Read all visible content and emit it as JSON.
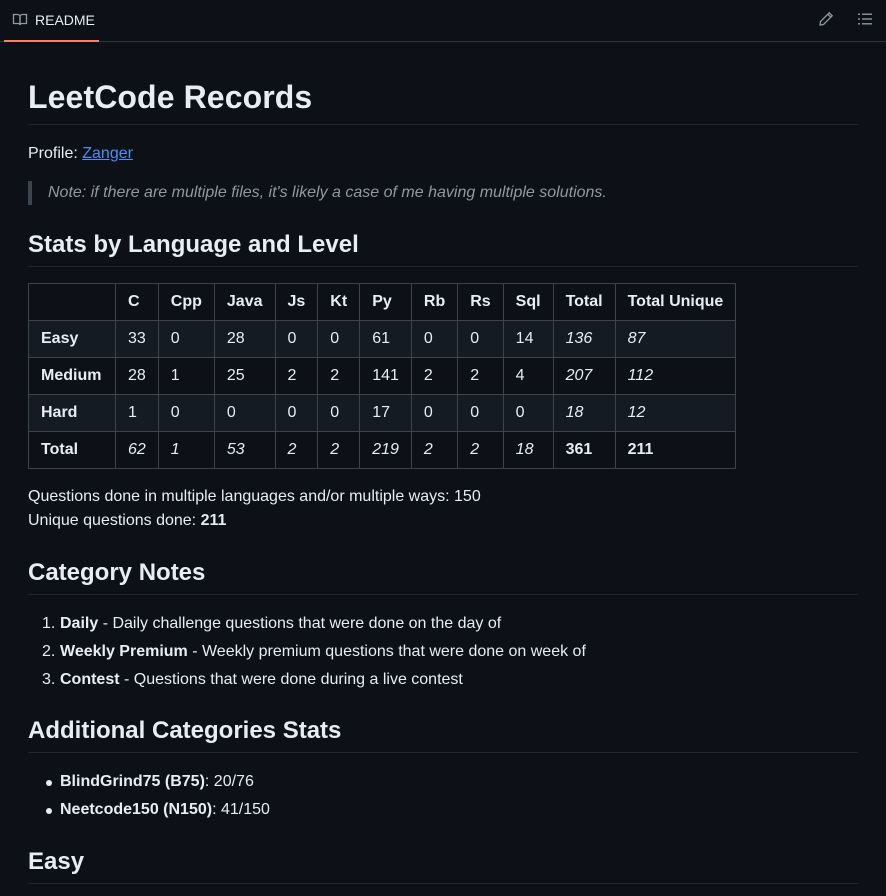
{
  "tab": {
    "label": "README"
  },
  "title": "LeetCode Records",
  "profile": {
    "label": "Profile: ",
    "link_text": "Zanger"
  },
  "note": "Note: if there are multiple files, it's likely a case of me having multiple solutions.",
  "section_stats": "Stats by Language and Level",
  "table": {
    "headers": [
      "",
      "C",
      "Cpp",
      "Java",
      "Js",
      "Kt",
      "Py",
      "Rb",
      "Rs",
      "Sql",
      "Total",
      "Total Unique"
    ],
    "rows": [
      [
        "Easy",
        "33",
        "0",
        "28",
        "0",
        "0",
        "61",
        "0",
        "0",
        "14",
        "136",
        "87"
      ],
      [
        "Medium",
        "28",
        "1",
        "25",
        "2",
        "2",
        "141",
        "2",
        "2",
        "4",
        "207",
        "112"
      ],
      [
        "Hard",
        "1",
        "0",
        "0",
        "0",
        "0",
        "17",
        "0",
        "0",
        "0",
        "18",
        "12"
      ],
      [
        "Total",
        "62",
        "1",
        "53",
        "2",
        "2",
        "219",
        "2",
        "2",
        "18",
        "361",
        "211"
      ]
    ]
  },
  "multi_line": "Questions done in multiple languages and/or multiple ways: 150",
  "unique_label": "Unique questions done: ",
  "unique_value": "211",
  "section_category": "Category Notes",
  "categories": [
    {
      "num": "1.",
      "name": "Daily",
      "desc": " - Daily challenge questions that were done on the day of"
    },
    {
      "num": "2.",
      "name": "Weekly Premium",
      "desc": " - Weekly premium questions that were done on week of"
    },
    {
      "num": "3.",
      "name": "Contest",
      "desc": " - Questions that were done during a live contest"
    }
  ],
  "section_additional": "Additional Categories Stats",
  "additional": [
    {
      "name": "BlindGrind75 (B75)",
      "value": ": 20/76"
    },
    {
      "name": "Neetcode150 (N150)",
      "value": ": 41/150"
    }
  ],
  "section_easy": "Easy",
  "colors": {
    "accent": "#f78166",
    "link": "#4493f8",
    "background": "#0d1117"
  },
  "icons": {
    "tab": "book-icon",
    "edit": "pencil-icon",
    "toc": "list-icon"
  }
}
